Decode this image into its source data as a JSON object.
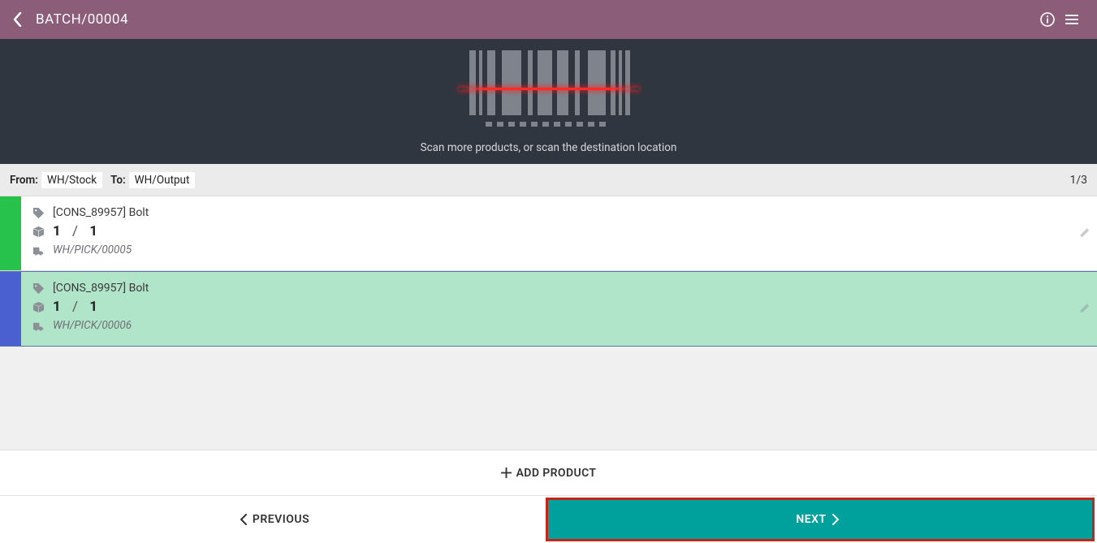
{
  "header": {
    "title": "BATCH/00004"
  },
  "scan_hint": "Scan more products, or scan the destination location",
  "location": {
    "from_label": "From:",
    "from_value": "WH/Stock",
    "to_label": "To:",
    "to_value": "WH/Output",
    "counter": "1/3"
  },
  "lines": [
    {
      "state": "done",
      "product": "[CONS_89957] Bolt",
      "qty_done": "1",
      "qty_sep": "/",
      "qty_expected": "1",
      "picking": "WH/PICK/00005"
    },
    {
      "state": "selected",
      "product": "[CONS_89957] Bolt",
      "qty_done": "1",
      "qty_sep": "/",
      "qty_expected": "1",
      "picking": "WH/PICK/00006"
    }
  ],
  "footer": {
    "add_product": "ADD PRODUCT",
    "previous": "PREVIOUS",
    "next": "NEXT"
  }
}
